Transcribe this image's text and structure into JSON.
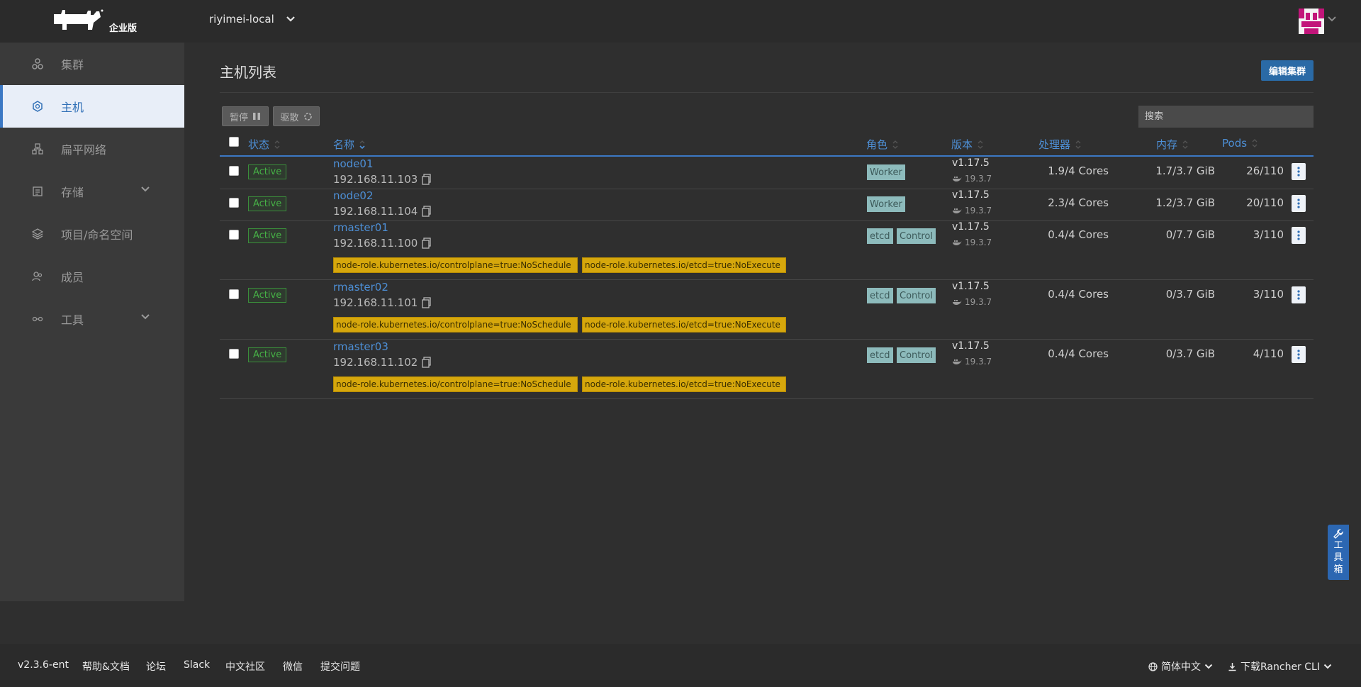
{
  "header": {
    "edition": "企业版",
    "cluster_name": "riyimei-local"
  },
  "sidebar": {
    "items": [
      {
        "label": "集群"
      },
      {
        "label": "主机"
      },
      {
        "label": "扁平网络"
      },
      {
        "label": "存储"
      },
      {
        "label": "项目/命名空间"
      },
      {
        "label": "成员"
      },
      {
        "label": "工具"
      }
    ]
  },
  "page": {
    "title": "主机列表",
    "edit_button": "编辑集群",
    "pause_button": "暂停",
    "drain_button": "驱散",
    "search_placeholder": "搜索"
  },
  "table": {
    "headers": {
      "status": "状态",
      "name": "名称",
      "role": "角色",
      "version": "版本",
      "cpu": "处理器",
      "memory": "内存",
      "pods": "Pods"
    },
    "rows": [
      {
        "status": "Active",
        "name": "node01",
        "ip": "192.168.11.103",
        "roles": [
          "Worker"
        ],
        "version": "v1.17.5",
        "docker": "19.3.7",
        "cpu": "1.9/4 Cores",
        "memory": "1.7/3.7 GiB",
        "pods": "26/110",
        "taints": []
      },
      {
        "status": "Active",
        "name": "node02",
        "ip": "192.168.11.104",
        "roles": [
          "Worker"
        ],
        "version": "v1.17.5",
        "docker": "19.3.7",
        "cpu": "2.3/4 Cores",
        "memory": "1.2/3.7 GiB",
        "pods": "20/110",
        "taints": []
      },
      {
        "status": "Active",
        "name": "rmaster01",
        "ip": "192.168.11.100",
        "roles": [
          "etcd",
          "Control"
        ],
        "version": "v1.17.5",
        "docker": "19.3.7",
        "cpu": "0.4/4 Cores",
        "memory": "0/7.7 GiB",
        "pods": "3/110",
        "taints": [
          "node-role.kubernetes.io/controlplane=true:NoSchedule",
          "node-role.kubernetes.io/etcd=true:NoExecute"
        ]
      },
      {
        "status": "Active",
        "name": "rmaster02",
        "ip": "192.168.11.101",
        "roles": [
          "etcd",
          "Control"
        ],
        "version": "v1.17.5",
        "docker": "19.3.7",
        "cpu": "0.4/4 Cores",
        "memory": "0/3.7 GiB",
        "pods": "3/110",
        "taints": [
          "node-role.kubernetes.io/controlplane=true:NoSchedule",
          "node-role.kubernetes.io/etcd=true:NoExecute"
        ]
      },
      {
        "status": "Active",
        "name": "rmaster03",
        "ip": "192.168.11.102",
        "roles": [
          "etcd",
          "Control"
        ],
        "version": "v1.17.5",
        "docker": "19.3.7",
        "cpu": "0.4/4 Cores",
        "memory": "0/3.7 GiB",
        "pods": "4/110",
        "taints": [
          "node-role.kubernetes.io/controlplane=true:NoSchedule",
          "node-role.kubernetes.io/etcd=true:NoExecute"
        ]
      }
    ]
  },
  "toolbox": {
    "chars": [
      "工",
      "具",
      "箱"
    ]
  },
  "footer": {
    "version": "v2.3.6-ent",
    "links": [
      "帮助&文档",
      "论坛",
      "Slack",
      "中文社区",
      "微信",
      "提交问题"
    ],
    "language": "简体中文",
    "cli": "下载Rancher CLI"
  }
}
